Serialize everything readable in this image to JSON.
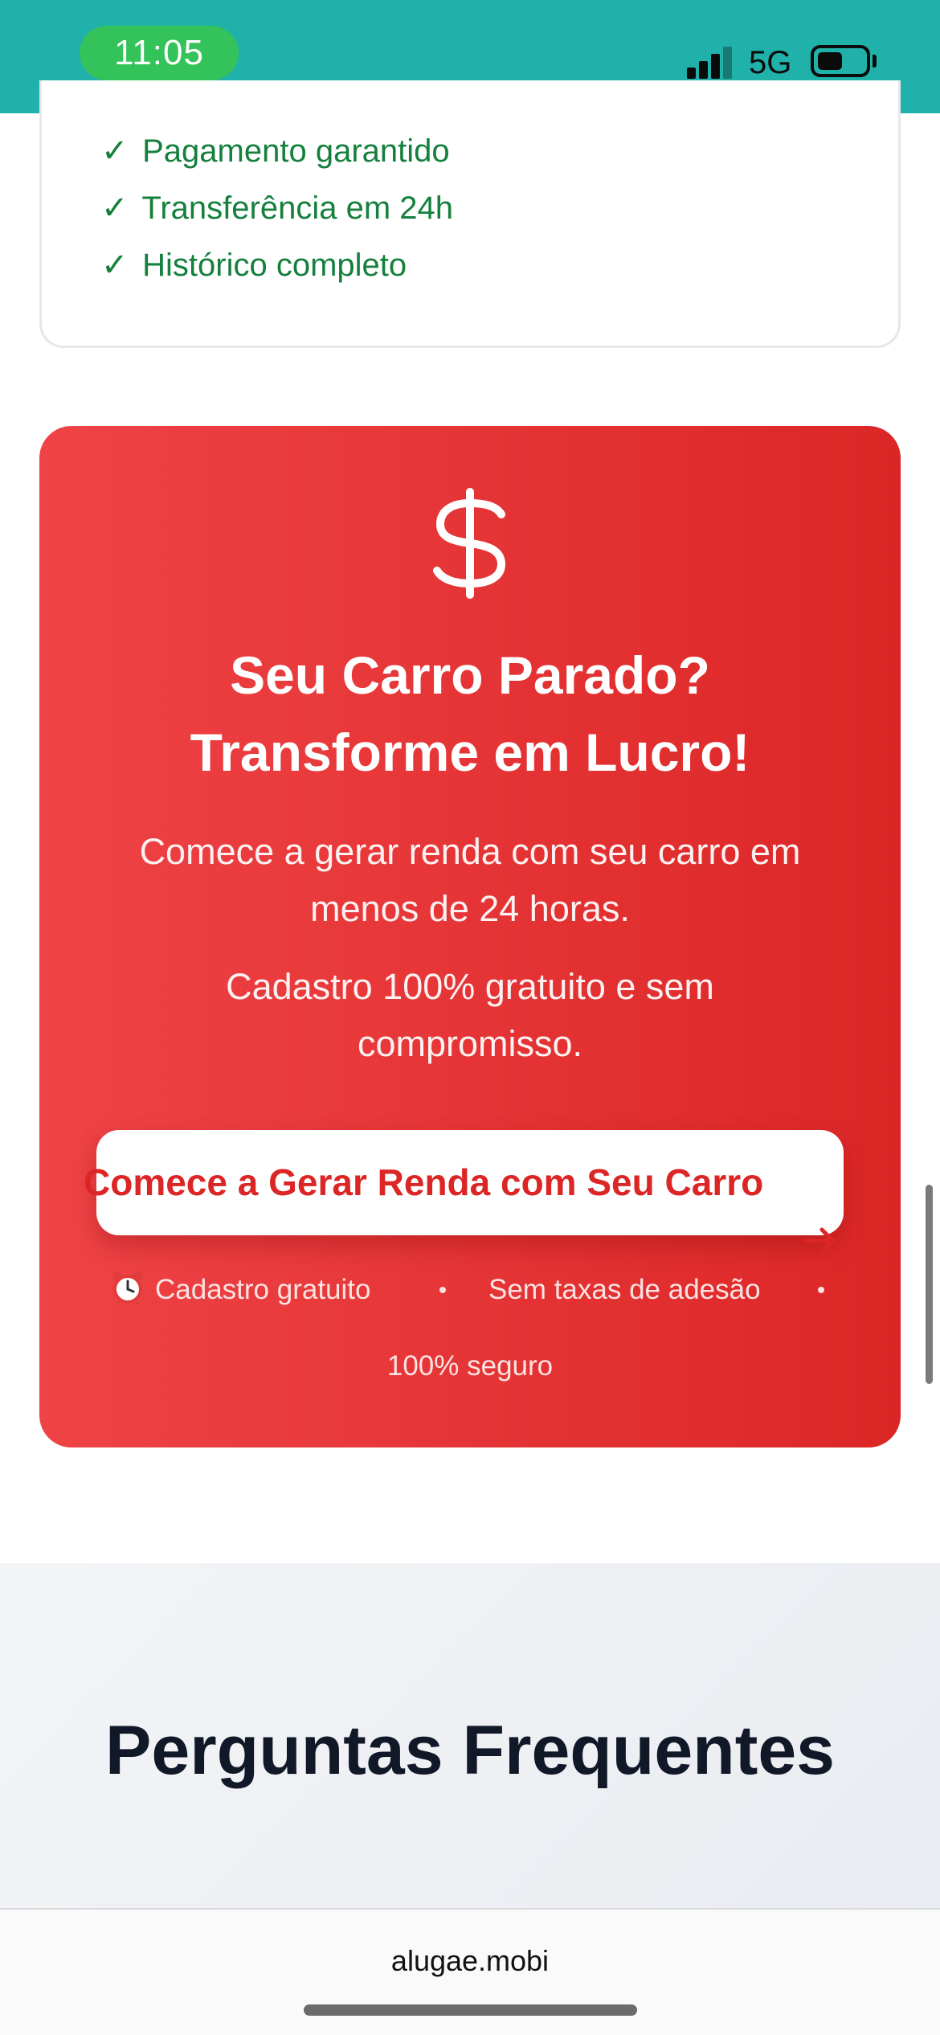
{
  "status_bar": {
    "time": "11:05",
    "network": "5G",
    "icons": [
      "cellular-signal-icon",
      "battery-icon"
    ],
    "colors": {
      "background": "#20b2aa",
      "time_pill": "#34c25a"
    }
  },
  "features": {
    "items": [
      {
        "check": "✓",
        "label": "Pagamento garantido"
      },
      {
        "check": "✓",
        "label": "Transferência em 24h"
      },
      {
        "check": "✓",
        "label": "Histórico completo"
      }
    ],
    "color": "#15803d"
  },
  "cta": {
    "icon": "dollar-sign-icon",
    "title_line1": "Seu Carro Parado?",
    "title_line2": "Transforme em Lucro!",
    "text1_line1": "Comece a gerar renda com seu carro em",
    "text1_line2": "menos de 24 horas.",
    "text2_line1": "Cadastro 100% gratuito e sem",
    "text2_line2": "compromisso.",
    "button_label": "Comece a Gerar Renda com Seu Carro",
    "button_icon": "arrow-right-icon",
    "perks": [
      {
        "icon": "alarm-clock-icon",
        "label": "Cadastro gratuito"
      },
      {
        "label": "Sem taxas de adesão"
      },
      {
        "label": "100% seguro"
      }
    ],
    "colors": {
      "gradient_start": "#ef4346",
      "gradient_end": "#dc2626",
      "button_text": "#dc2626"
    }
  },
  "faq": {
    "title": "Perguntas Frequentes"
  },
  "browser": {
    "url": "alugae.mobi"
  }
}
